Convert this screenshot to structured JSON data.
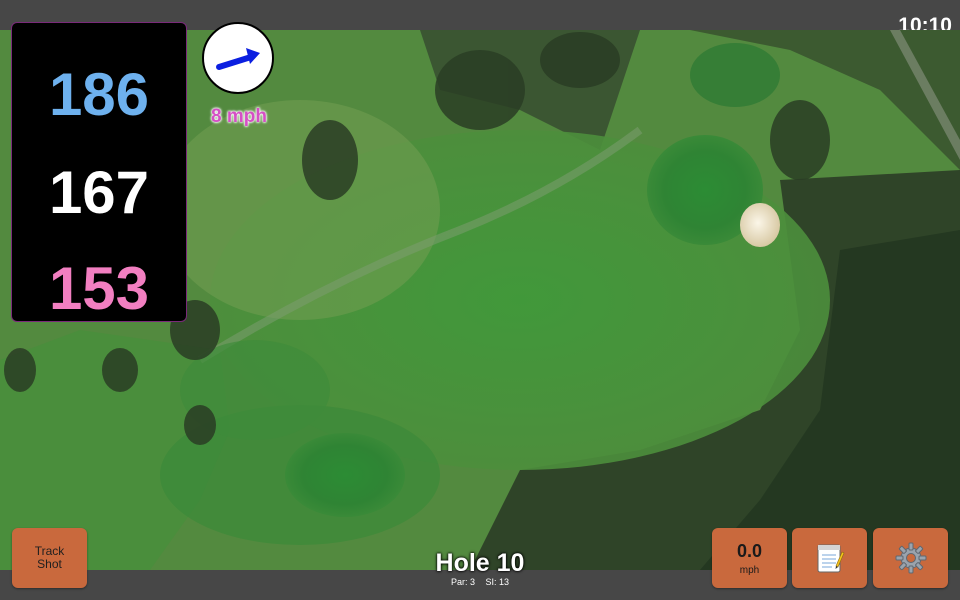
{
  "status_bar": {
    "time": "10:10"
  },
  "distances": {
    "back": "186",
    "middle": "167",
    "front": "153"
  },
  "wind": {
    "speed": "8 mph",
    "direction_icon": "arrow-icon",
    "arrow_color": "#0b1fe0"
  },
  "hole": {
    "title": "Hole 10",
    "par": "Par: 3",
    "stroke_index": "SI: 13"
  },
  "buttons": {
    "track_shot": "Track Shot",
    "speed_value": "0.0",
    "speed_unit": "mph",
    "notes_icon": "notepad-icon",
    "settings_icon": "gear-icon"
  },
  "colors": {
    "back_distance": "#6eb1ee",
    "middle_distance": "#ffffff",
    "front_distance": "#f27fc1",
    "button": "#c9693d",
    "wind_text": "#d54fc5"
  }
}
